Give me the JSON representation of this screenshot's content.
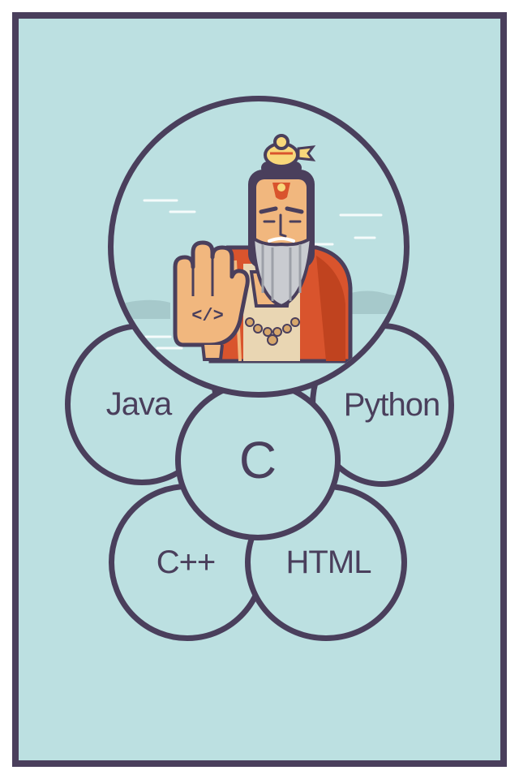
{
  "languages": {
    "java": "Java",
    "python": "Python",
    "c": "C",
    "cpp": "C++",
    "html": "HTML"
  },
  "hero": {
    "palm_tag": "</>",
    "illustration": "sadhu-stop-hand-icon"
  },
  "colors": {
    "background": "#bce0e1",
    "outline": "#4a3f5c",
    "skin": "#f1b77e",
    "robe": "#d9542d"
  }
}
